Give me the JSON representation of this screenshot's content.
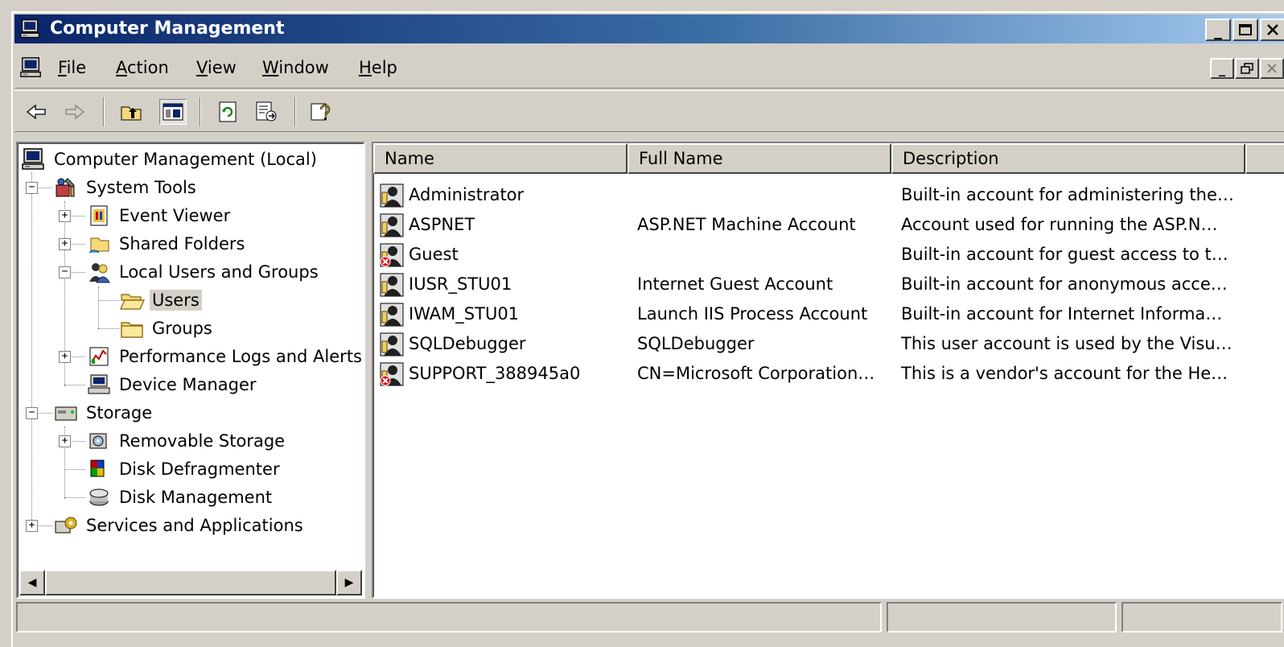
{
  "window": {
    "title": "Computer Management"
  },
  "menu": [
    {
      "label": "File",
      "accel": "F",
      "rest": "ile"
    },
    {
      "label": "Action",
      "accel": "A",
      "rest": "ction"
    },
    {
      "label": "View",
      "accel": "V",
      "rest": "iew"
    },
    {
      "label": "Window",
      "accel": "W",
      "rest": "indow"
    },
    {
      "label": "Help",
      "accel": "H",
      "rest": "elp"
    }
  ],
  "toolbar": [
    "back-icon",
    "forward-icon",
    "up-folder-icon",
    "show-hide-tree-icon",
    "refresh-icon",
    "export-list-icon",
    "help-icon"
  ],
  "tree": {
    "root": "Computer Management (Local)",
    "system_tools": "System Tools",
    "event_viewer": "Event Viewer",
    "shared_folders": "Shared Folders",
    "local_users_groups": "Local Users and Groups",
    "users": "Users",
    "groups": "Groups",
    "perf_logs": "Performance Logs and Alerts",
    "device_manager": "Device Manager",
    "storage": "Storage",
    "removable_storage": "Removable Storage",
    "disk_defrag": "Disk Defragmenter",
    "disk_mgmt": "Disk Management",
    "services_apps": "Services and Applications",
    "selected": "Users"
  },
  "list": {
    "columns": [
      "Name",
      "Full Name",
      "Description"
    ],
    "rows": [
      {
        "name": "Administrator",
        "full_name": "",
        "description": "Built-in account for administering the…",
        "disabled": false
      },
      {
        "name": "ASPNET",
        "full_name": "ASP.NET Machine Account",
        "description": "Account used for running the ASP.N…",
        "disabled": false
      },
      {
        "name": "Guest",
        "full_name": "",
        "description": "Built-in account for guest access to t…",
        "disabled": true
      },
      {
        "name": "IUSR_STU01",
        "full_name": "Internet Guest Account",
        "description": "Built-in account for anonymous acce…",
        "disabled": false
      },
      {
        "name": "IWAM_STU01",
        "full_name": "Launch IIS Process Account",
        "description": "Built-in account for Internet Informa…",
        "disabled": false
      },
      {
        "name": "SQLDebugger",
        "full_name": "SQLDebugger",
        "description": "This user account is used by the Visu…",
        "disabled": false
      },
      {
        "name": "SUPPORT_388945a0",
        "full_name": "CN=Microsoft Corporation…",
        "description": "This is a vendor's account for the He…",
        "disabled": true
      }
    ]
  },
  "colors": {
    "title_start": "#0a246a",
    "title_end": "#a6caf0",
    "face": "#d4d0c8",
    "disabled_badge": "#e01010"
  }
}
